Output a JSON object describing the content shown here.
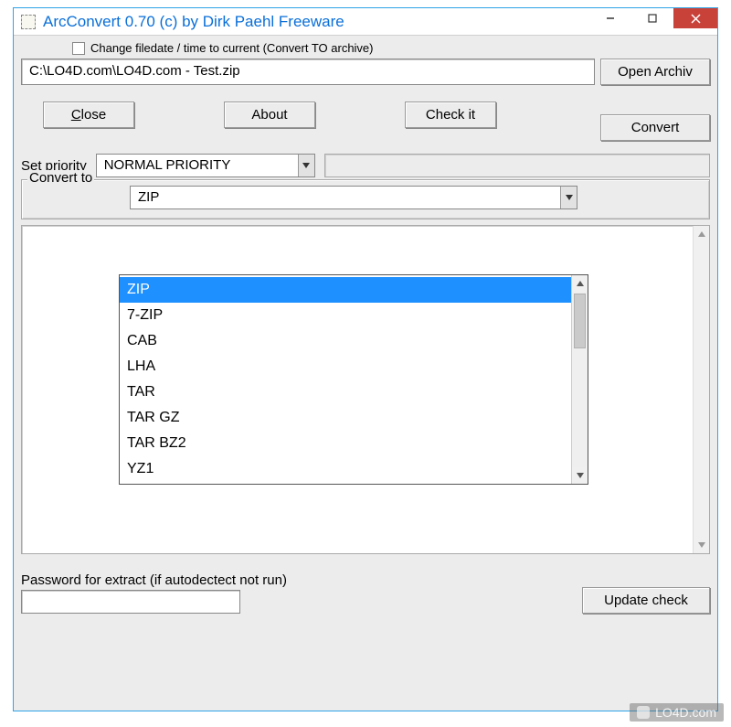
{
  "titlebar": {
    "title": "ArcConvert 0.70 (c) by Dirk Paehl Freeware"
  },
  "checkbox": {
    "label": "Change filedate / time to current (Convert TO archive)"
  },
  "path": {
    "value": "C:\\LO4D.com\\LO4D.com - Test.zip",
    "open_button": "Open Archiv"
  },
  "buttons": {
    "close": "Close",
    "about": "About",
    "check_it": "Check it",
    "convert": "Convert",
    "update_check": "Update check"
  },
  "priority": {
    "label": "Set priority",
    "value": "NORMAL PRIORITY"
  },
  "convert_to": {
    "legend": "Convert to",
    "value": "ZIP",
    "options": [
      "ZIP",
      "7-ZIP",
      "CAB",
      "LHA",
      "TAR",
      "TAR GZ",
      "TAR BZ2",
      "YZ1"
    ]
  },
  "password": {
    "label": "Password for extract (if autodectect not run)"
  },
  "watermark": {
    "text": "LO4D.com"
  }
}
